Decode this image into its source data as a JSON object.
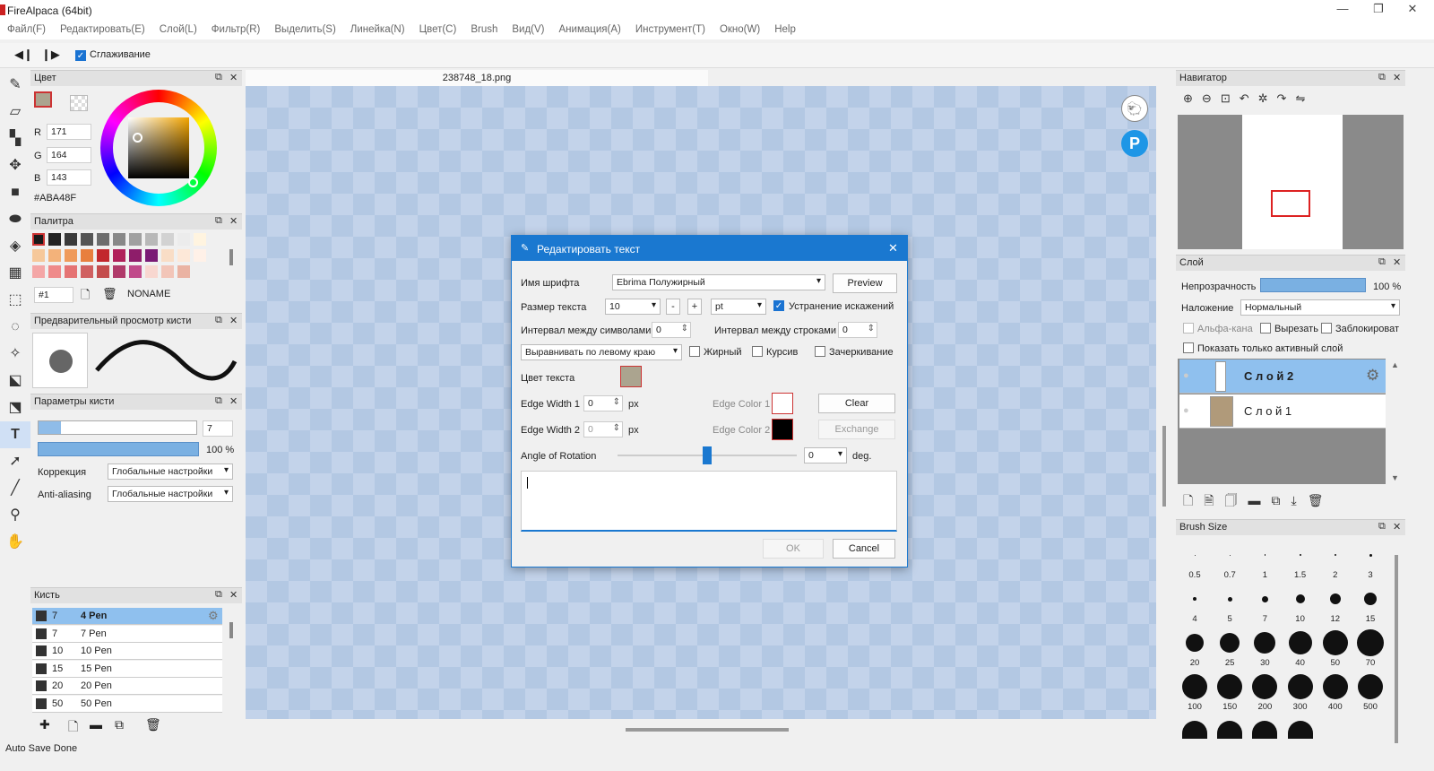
{
  "window": {
    "title": "FireAlpaca (64bit)",
    "minimize": "—",
    "maximize": "❐",
    "close": "✕"
  },
  "menu": [
    "Файл(F)",
    "Редактировать(E)",
    "Слой(L)",
    "Фильтр(R)",
    "Выделить(S)",
    "Линейка(N)",
    "Цвет(C)",
    "Brush",
    "Вид(V)",
    "Анимация(A)",
    "Инструмент(T)",
    "Окно(W)",
    "Help"
  ],
  "toolbar": {
    "antialias_label": "Сглаживание",
    "antialias_checked": true
  },
  "color_panel": {
    "title": "Цвет",
    "r_label": "R",
    "r": "171",
    "g_label": "G",
    "g": "164",
    "b_label": "B",
    "b": "143",
    "hex": "#ABA48F",
    "current_color": "#aba48f"
  },
  "palette_panel": {
    "title": "Палитра",
    "number": "#1",
    "name": "NONAME",
    "colors": [
      "#1a1a1a",
      "#222222",
      "#3a3a3a",
      "#555555",
      "#6d6d6d",
      "#888888",
      "#a0a0a0",
      "#b8b8b8",
      "#d2d2d2",
      "#ececec",
      "#fff4e0",
      "#f6c89a",
      "#f3b27a",
      "#ef9a5a",
      "#e87f3e",
      "#c2272d",
      "#b0205a",
      "#8e1d6a",
      "#7a1a75",
      "#f9ddc6",
      "#fde8d8",
      "#fff1e8",
      "#f4a6a6",
      "#ef8a8a",
      "#e57373",
      "#d06060",
      "#c44d4d",
      "#b03a6a",
      "#c04a8a",
      "#f8d7d0",
      "#f2c5b8",
      "#eab3a3"
    ]
  },
  "brush_preview": {
    "title": "Предварительный просмотр кисти"
  },
  "brush_params": {
    "title": "Параметры кисти",
    "size": "7",
    "opacity": "100 %",
    "correction_label": "Коррекция",
    "correction_value": "Глобальные настройки",
    "aa_label": "Anti-aliasing",
    "aa_value": "Глобальные настройки"
  },
  "brush_panel": {
    "title": "Кисть",
    "items": [
      {
        "num": "7",
        "name": "4 Pen"
      },
      {
        "num": "7",
        "name": "7 Pen"
      },
      {
        "num": "10",
        "name": "10 Pen"
      },
      {
        "num": "15",
        "name": "15 Pen"
      },
      {
        "num": "20",
        "name": "20 Pen"
      },
      {
        "num": "50",
        "name": "50 Pen"
      }
    ]
  },
  "status": "Auto Save Done",
  "document": {
    "tab": "238748_18.png"
  },
  "dialog": {
    "title": "Редактировать текст",
    "font_label": "Имя шрифта",
    "font_value": "Ebrima Полужирный",
    "preview": "Preview",
    "size_label": "Размер текста",
    "size_value": "10",
    "minus": "-",
    "plus": "+",
    "unit": "pt",
    "antialias": "Устранение искажений",
    "char_spacing_label": "Интервал между символами",
    "char_spacing": "0",
    "line_spacing_label": "Интервал между строками",
    "line_spacing": "0",
    "align_value": "Выравнивать по левому краю",
    "bold": "Жирный",
    "italic": "Курсив",
    "strike": "Зачеркивание",
    "text_color_label": "Цвет текста",
    "text_color": "#aba48f",
    "edge1_label": "Edge Width 1",
    "edge1": "0",
    "px1": "px",
    "edgecolor1_label": "Edge Color 1",
    "edgecolor1": "#ffffff",
    "clear": "Clear",
    "edge2_label": "Edge Width 2",
    "edge2": "0",
    "px2": "px",
    "edgecolor2_label": "Edge Color 2",
    "edgecolor2": "#000000",
    "exchange": "Exchange",
    "rotation_label": "Angle of Rotation",
    "rotation": "0",
    "deg": "deg.",
    "rotation_level": 0.5,
    "ok": "OK",
    "cancel": "Cancel"
  },
  "navigator": {
    "title": "Навигатор"
  },
  "layer_panel": {
    "title": "Слой",
    "opacity_label": "Непрозрачность",
    "opacity": "100 %",
    "blend_label": "Наложение",
    "blend_value": "Нормальный",
    "alpha": "Альфа-кана",
    "clip": "Вырезать",
    "lock": "Заблокироват",
    "show_active": "Показать только активный слой",
    "layers": [
      {
        "name": "С л о й 2"
      },
      {
        "name": "С л о й 1"
      }
    ]
  },
  "brush_size": {
    "title": "Brush Size",
    "sizes": [
      "0.5",
      "0.7",
      "1",
      "1.5",
      "2",
      "3",
      "4",
      "5",
      "7",
      "10",
      "12",
      "15",
      "20",
      "25",
      "30",
      "40",
      "50",
      "70",
      "100",
      "150",
      "200",
      "300",
      "400",
      "500"
    ]
  }
}
